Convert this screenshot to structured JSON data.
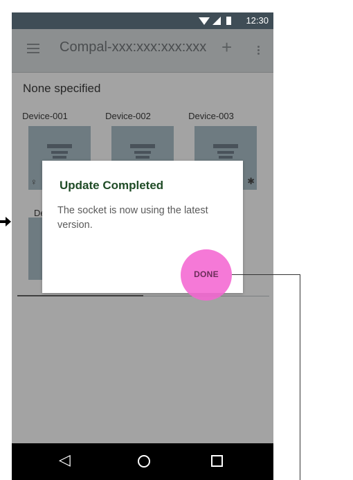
{
  "status_bar": {
    "time": "12:30"
  },
  "app_bar": {
    "title": "Compal-xxx:xxx:xxx:xxx",
    "add_icon": "plus-icon",
    "menu_icon": "hamburger-menu-icon",
    "more_icon": "more-vert-icon"
  },
  "section": {
    "title": "None specified"
  },
  "devices": [
    {
      "label": "Device-001"
    },
    {
      "label": "Device-002"
    },
    {
      "label": "Device-003"
    },
    {
      "label": "De"
    }
  ],
  "dialog": {
    "title": "Update Completed",
    "body": "The socket is now using the latest version.",
    "done_label": "DONE"
  },
  "progress": {
    "fraction": 0.5
  },
  "nav_bar": {
    "icons": [
      "back-icon",
      "home-icon",
      "recents-icon"
    ]
  },
  "colors": {
    "dialog_title": "#1f4b26",
    "highlight": "#f466d2",
    "status_bar": "#3f4d56"
  }
}
